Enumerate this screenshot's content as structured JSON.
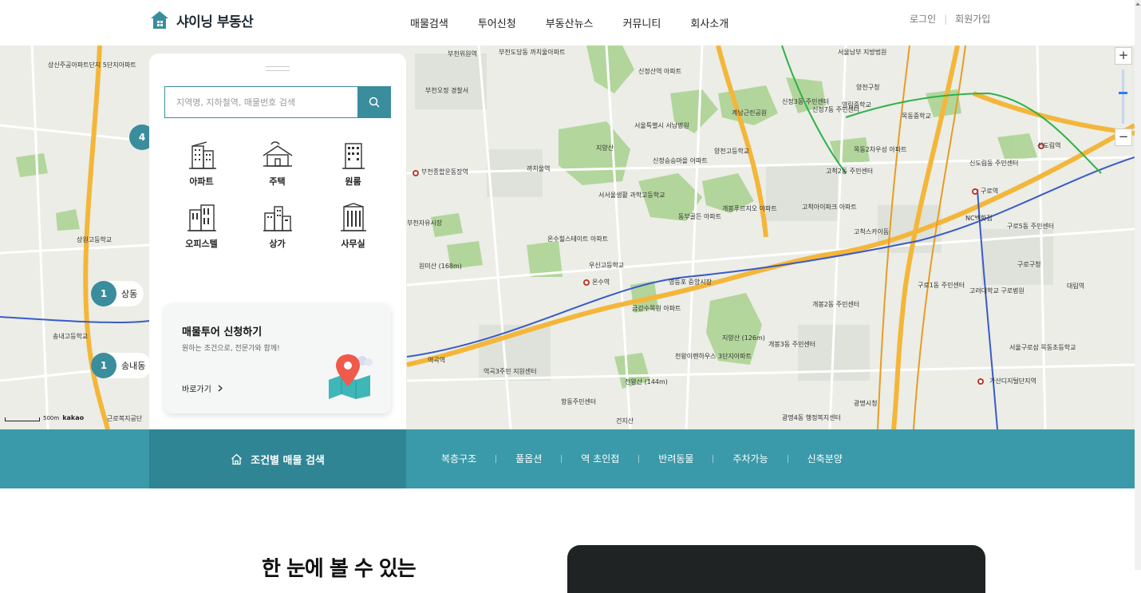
{
  "header": {
    "logo_text": "샤이닝 부동산",
    "nav": [
      "매물검색",
      "투어신청",
      "부동산뉴스",
      "커뮤니티",
      "회사소개"
    ],
    "login": "로그인",
    "signup": "회원가입"
  },
  "search": {
    "placeholder": "지역명, 지하철역, 매물번호 검색"
  },
  "property_types": [
    {
      "label": "아파트",
      "icon": "apartment-icon"
    },
    {
      "label": "주택",
      "icon": "house-icon"
    },
    {
      "label": "원룸",
      "icon": "studio-icon"
    },
    {
      "label": "오피스텔",
      "icon": "officetel-icon"
    },
    {
      "label": "상가",
      "icon": "store-icon"
    },
    {
      "label": "사무실",
      "icon": "office-icon"
    }
  ],
  "tour": {
    "title": "매물투어 신청하기",
    "subtitle": "원하는 조건으로, 전문가와 함께!",
    "link": "바로가기"
  },
  "map": {
    "clusters": [
      {
        "count": "4",
        "label": ""
      },
      {
        "count": "1",
        "label": "상동"
      },
      {
        "count": "1",
        "label": "송내동"
      }
    ],
    "scale_text": "500m",
    "provider": "kakao",
    "zoom_in": "+",
    "zoom_out": "−",
    "labels": {
      "l1": "상신주공아파트단지 5단지아파트",
      "l2": "부천위원역",
      "l3": "부천도당동 까치울아파트",
      "l4": "신정산역 아파트",
      "l5": "서울남부 지방법원",
      "l6": "양천구청",
      "l7": "서울특별시 서남병원",
      "l8": "신정3동 주민센터",
      "l9": "신정7동 주민센터",
      "l10": "목동2차우성 아파트",
      "l11": "신도림역",
      "l12": "구로역",
      "l13": "NC백화점",
      "l14": "구로구청",
      "l15": "고척2동 주민센터",
      "l16": "고척스카이돔",
      "l17": "개봉푸르지오 아파트",
      "l18": "개봉2동 주민센터",
      "l19": "개봉3동 주민센터",
      "l20": "광명시청",
      "l21": "가산디지털단지역",
      "l22": "우신고등학교",
      "l23": "온수역",
      "l24": "역곡역",
      "l25": "부천자유시장",
      "l26": "원미산 (168m)",
      "l27": "지양산",
      "l28": "지양산 (126m)",
      "l29": "신정승승마을 아파트",
      "l30": "영등포 중앙시장",
      "l31": "구로1동 주민센터",
      "l32": "천왕이펜하우스 3단지아파트",
      "l33": "천왕산 (144m)",
      "l34": "건지산",
      "l35": "광명4동 행정복지센터",
      "l36": "항동주민센터",
      "l37": "역곡3주민 지원센터",
      "l38": "근로복지공단",
      "l39": "상원고등학교",
      "l40": "송내고등학교",
      "l41": "부천종합운동장역",
      "l42": "까치울역",
      "l43": "온수힐스테이트 아파트",
      "l44": "금강수목원 아파트",
      "l45": "서서울생활 과학고등학교",
      "l46": "고척아이파크 아파트",
      "l47": "영림중학교",
      "l48": "동부골든 아파트",
      "l49": "구로5동 주민센터",
      "l50": "고려대학교 구로병원",
      "l51": "대림역",
      "l52": "신도림동 주민센터",
      "l53": "서울구로삼 목동초등학교",
      "l54": "양천고등학교",
      "l55": "계남근린공원",
      "l56": "목동중학교",
      "l57": "부천오정 경찰서"
    }
  },
  "conditions": {
    "title": "조건별 매물 검색",
    "items": [
      "복층구조",
      "풀옵션",
      "역 초인접",
      "반려동물",
      "주차가능",
      "신축분양"
    ]
  },
  "section": {
    "headline": "한 눈에 볼 수 있는"
  },
  "colors": {
    "primary": "#3a9aa9",
    "primary_dark": "#2f8593",
    "search_border": "#3a8d9c"
  }
}
